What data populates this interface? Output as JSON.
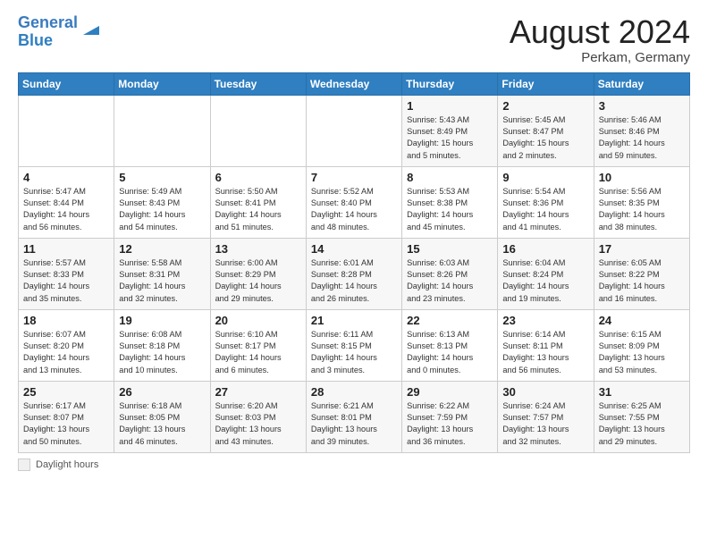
{
  "header": {
    "logo_general": "General",
    "logo_blue": "Blue",
    "month_year": "August 2024",
    "location": "Perkam, Germany"
  },
  "days_of_week": [
    "Sunday",
    "Monday",
    "Tuesday",
    "Wednesday",
    "Thursday",
    "Friday",
    "Saturday"
  ],
  "weeks": [
    [
      {
        "day": "",
        "info": ""
      },
      {
        "day": "",
        "info": ""
      },
      {
        "day": "",
        "info": ""
      },
      {
        "day": "",
        "info": ""
      },
      {
        "day": "1",
        "info": "Sunrise: 5:43 AM\nSunset: 8:49 PM\nDaylight: 15 hours\nand 5 minutes."
      },
      {
        "day": "2",
        "info": "Sunrise: 5:45 AM\nSunset: 8:47 PM\nDaylight: 15 hours\nand 2 minutes."
      },
      {
        "day": "3",
        "info": "Sunrise: 5:46 AM\nSunset: 8:46 PM\nDaylight: 14 hours\nand 59 minutes."
      }
    ],
    [
      {
        "day": "4",
        "info": "Sunrise: 5:47 AM\nSunset: 8:44 PM\nDaylight: 14 hours\nand 56 minutes."
      },
      {
        "day": "5",
        "info": "Sunrise: 5:49 AM\nSunset: 8:43 PM\nDaylight: 14 hours\nand 54 minutes."
      },
      {
        "day": "6",
        "info": "Sunrise: 5:50 AM\nSunset: 8:41 PM\nDaylight: 14 hours\nand 51 minutes."
      },
      {
        "day": "7",
        "info": "Sunrise: 5:52 AM\nSunset: 8:40 PM\nDaylight: 14 hours\nand 48 minutes."
      },
      {
        "day": "8",
        "info": "Sunrise: 5:53 AM\nSunset: 8:38 PM\nDaylight: 14 hours\nand 45 minutes."
      },
      {
        "day": "9",
        "info": "Sunrise: 5:54 AM\nSunset: 8:36 PM\nDaylight: 14 hours\nand 41 minutes."
      },
      {
        "day": "10",
        "info": "Sunrise: 5:56 AM\nSunset: 8:35 PM\nDaylight: 14 hours\nand 38 minutes."
      }
    ],
    [
      {
        "day": "11",
        "info": "Sunrise: 5:57 AM\nSunset: 8:33 PM\nDaylight: 14 hours\nand 35 minutes."
      },
      {
        "day": "12",
        "info": "Sunrise: 5:58 AM\nSunset: 8:31 PM\nDaylight: 14 hours\nand 32 minutes."
      },
      {
        "day": "13",
        "info": "Sunrise: 6:00 AM\nSunset: 8:29 PM\nDaylight: 14 hours\nand 29 minutes."
      },
      {
        "day": "14",
        "info": "Sunrise: 6:01 AM\nSunset: 8:28 PM\nDaylight: 14 hours\nand 26 minutes."
      },
      {
        "day": "15",
        "info": "Sunrise: 6:03 AM\nSunset: 8:26 PM\nDaylight: 14 hours\nand 23 minutes."
      },
      {
        "day": "16",
        "info": "Sunrise: 6:04 AM\nSunset: 8:24 PM\nDaylight: 14 hours\nand 19 minutes."
      },
      {
        "day": "17",
        "info": "Sunrise: 6:05 AM\nSunset: 8:22 PM\nDaylight: 14 hours\nand 16 minutes."
      }
    ],
    [
      {
        "day": "18",
        "info": "Sunrise: 6:07 AM\nSunset: 8:20 PM\nDaylight: 14 hours\nand 13 minutes."
      },
      {
        "day": "19",
        "info": "Sunrise: 6:08 AM\nSunset: 8:18 PM\nDaylight: 14 hours\nand 10 minutes."
      },
      {
        "day": "20",
        "info": "Sunrise: 6:10 AM\nSunset: 8:17 PM\nDaylight: 14 hours\nand 6 minutes."
      },
      {
        "day": "21",
        "info": "Sunrise: 6:11 AM\nSunset: 8:15 PM\nDaylight: 14 hours\nand 3 minutes."
      },
      {
        "day": "22",
        "info": "Sunrise: 6:13 AM\nSunset: 8:13 PM\nDaylight: 14 hours\nand 0 minutes."
      },
      {
        "day": "23",
        "info": "Sunrise: 6:14 AM\nSunset: 8:11 PM\nDaylight: 13 hours\nand 56 minutes."
      },
      {
        "day": "24",
        "info": "Sunrise: 6:15 AM\nSunset: 8:09 PM\nDaylight: 13 hours\nand 53 minutes."
      }
    ],
    [
      {
        "day": "25",
        "info": "Sunrise: 6:17 AM\nSunset: 8:07 PM\nDaylight: 13 hours\nand 50 minutes."
      },
      {
        "day": "26",
        "info": "Sunrise: 6:18 AM\nSunset: 8:05 PM\nDaylight: 13 hours\nand 46 minutes."
      },
      {
        "day": "27",
        "info": "Sunrise: 6:20 AM\nSunset: 8:03 PM\nDaylight: 13 hours\nand 43 minutes."
      },
      {
        "day": "28",
        "info": "Sunrise: 6:21 AM\nSunset: 8:01 PM\nDaylight: 13 hours\nand 39 minutes."
      },
      {
        "day": "29",
        "info": "Sunrise: 6:22 AM\nSunset: 7:59 PM\nDaylight: 13 hours\nand 36 minutes."
      },
      {
        "day": "30",
        "info": "Sunrise: 6:24 AM\nSunset: 7:57 PM\nDaylight: 13 hours\nand 32 minutes."
      },
      {
        "day": "31",
        "info": "Sunrise: 6:25 AM\nSunset: 7:55 PM\nDaylight: 13 hours\nand 29 minutes."
      }
    ]
  ],
  "footer": {
    "legend_label": "Daylight hours"
  }
}
